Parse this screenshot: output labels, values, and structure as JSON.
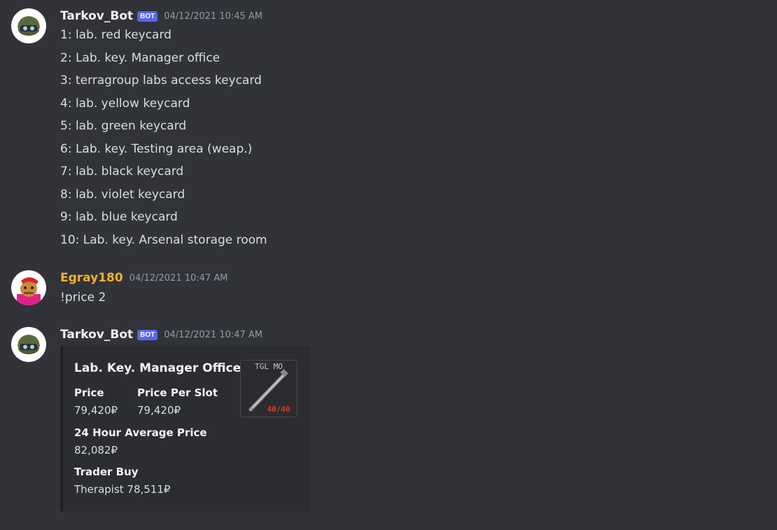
{
  "messages": [
    {
      "author": "Tarkov_Bot",
      "badge": "BOT",
      "timestamp": "04/12/2021 10:45 AM",
      "author_color": "#f2f3f5",
      "lines": [
        "1: lab. red keycard",
        "2: Lab. key. Manager office",
        "3: terragroup labs access keycard",
        "4: lab. yellow keycard",
        "5: lab. green keycard",
        "6: Lab. key. Testing area (weap.)",
        "7: lab. black keycard",
        "8: lab. violet keycard",
        "9: lab. blue keycard",
        "10: Lab. key. Arsenal storage room"
      ]
    },
    {
      "author": "Egray180",
      "timestamp": "04/12/2021 10:47 AM",
      "author_color": "#f0b232",
      "lines": [
        "!price 2"
      ]
    },
    {
      "author": "Tarkov_Bot",
      "badge": "BOT",
      "timestamp": "04/12/2021 10:47 AM",
      "author_color": "#f2f3f5",
      "embed": {
        "title": "Lab. Key. Manager Office",
        "thumbnail": {
          "label": "TGL MO",
          "durability": "40/40",
          "icon": "key-icon"
        },
        "fields": {
          "price": {
            "name": "Price",
            "value": "79,420₽"
          },
          "price_per_slot": {
            "name": "Price Per Slot",
            "value": "79,420₽"
          },
          "avg_price": {
            "name": "24 Hour Average Price",
            "value": "82,082₽"
          },
          "trader_buy": {
            "name": "Trader Buy",
            "value": "Therapist 78,511₽"
          }
        }
      }
    }
  ],
  "colors": {
    "background": "#313338",
    "embed_background": "#2b2d31",
    "bot_badge": "#5865f2",
    "timestamp": "#949ba4"
  }
}
